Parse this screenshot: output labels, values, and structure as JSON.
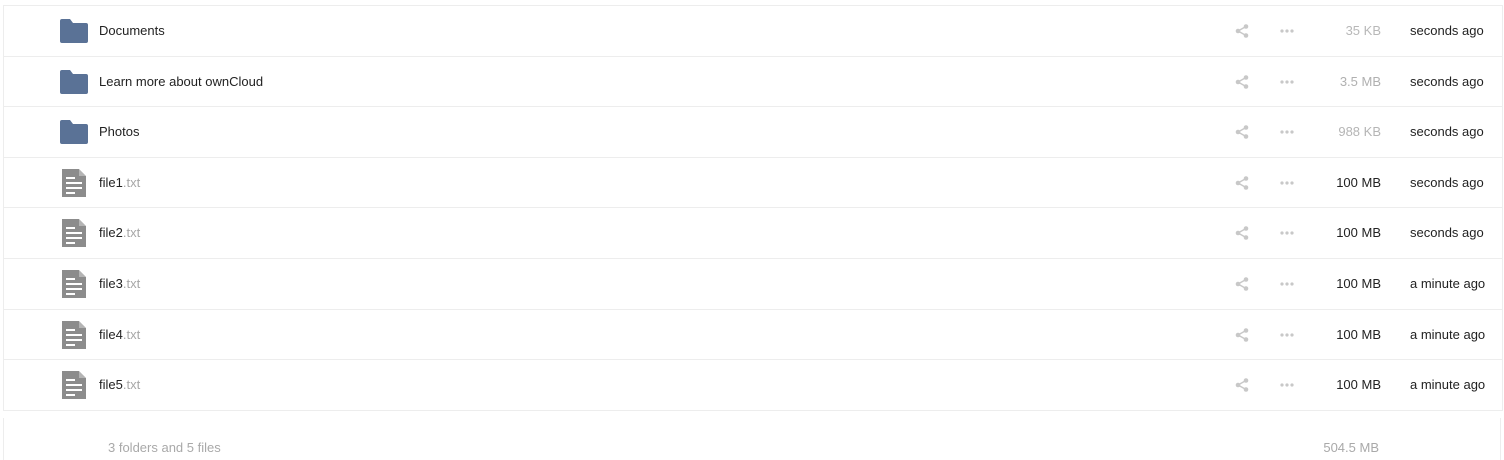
{
  "colors": {
    "folder": "#5a7296",
    "file_icon": "#8c8c8c",
    "action_icon": "#c8c8c8",
    "muted_text": "#a9a9a9"
  },
  "icons": {
    "share": "share-icon",
    "more": "more-dots-icon",
    "folder": "folder-icon",
    "text_file": "text-file-icon"
  },
  "files": [
    {
      "type": "folder",
      "name": "Documents",
      "ext": "",
      "size": "35 KB",
      "size_color": "#b8b8b8",
      "modified": "seconds ago"
    },
    {
      "type": "folder",
      "name": "Learn more about ownCloud",
      "ext": "",
      "size": "3.5 MB",
      "size_color": "#b0b0b0",
      "modified": "seconds ago"
    },
    {
      "type": "folder",
      "name": "Photos",
      "ext": "",
      "size": "988 KB",
      "size_color": "#b5b5b5",
      "modified": "seconds ago"
    },
    {
      "type": "file",
      "name": "file1",
      "ext": ".txt",
      "size": "100 MB",
      "size_color": "#222222",
      "modified": "seconds ago"
    },
    {
      "type": "file",
      "name": "file2",
      "ext": ".txt",
      "size": "100 MB",
      "size_color": "#222222",
      "modified": "seconds ago"
    },
    {
      "type": "file",
      "name": "file3",
      "ext": ".txt",
      "size": "100 MB",
      "size_color": "#222222",
      "modified": "a minute ago"
    },
    {
      "type": "file",
      "name": "file4",
      "ext": ".txt",
      "size": "100 MB",
      "size_color": "#222222",
      "modified": "a minute ago"
    },
    {
      "type": "file",
      "name": "file5",
      "ext": ".txt",
      "size": "100 MB",
      "size_color": "#222222",
      "modified": "a minute ago"
    }
  ],
  "summary": {
    "info": "3 folders and 5 files",
    "total_size": "504.5 MB"
  }
}
